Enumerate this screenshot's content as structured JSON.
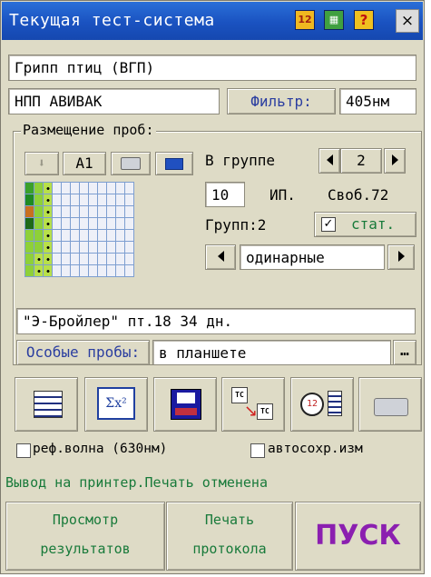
{
  "window": {
    "title": "Текущая тест-система",
    "close_label": "×",
    "icons": [
      "calc-icon",
      "table-icon",
      "help-icon"
    ]
  },
  "test_system": "Грипп птиц (ВГП)",
  "kit": "НПП АВИВАК",
  "filter": {
    "label": "Фильтр:",
    "value": "405нм"
  },
  "placement": {
    "legend": "Размещение проб:",
    "position_label": "А1",
    "in_group_label": "В группе",
    "in_group_value": "2",
    "count_value": "10",
    "ip_label": "ИП.",
    "free_label": "Своб.72",
    "groups_label": "Групп:2",
    "stat_label": "стат.",
    "stat_checked": true,
    "mode_value": "одинарные"
  },
  "plate": {
    "columns": 12,
    "rows": 8,
    "fills": [
      [
        "#3aa02a",
        "#8ed038",
        "#b8e04a"
      ],
      [
        "#1e8a22",
        "#8ed038",
        "#b8e04a"
      ],
      [
        "#c87020",
        "#8ed038",
        "#b8e04a"
      ],
      [
        "#1e6a18",
        "#8ed038",
        "#b8e04a"
      ],
      [
        "#8ed038",
        "#8ed038",
        "#b8e04a"
      ],
      [
        "#8ed038",
        "#8ed038",
        "#b8e04a"
      ],
      [
        "#8ed038",
        "#b8e04a",
        "#b8e04a"
      ],
      [
        "#8ed038",
        "#b8e04a",
        "#b8e04a"
      ]
    ]
  },
  "sample_info": "\"Э-Бройлер\" пт.18 34 дн.",
  "special": {
    "label": "Особые пробы:",
    "value": "в планшете",
    "more_label": "…"
  },
  "toolbar": {
    "icons": [
      "samples-icon",
      "calc-formula-icon",
      "save-icon",
      "tc-transfer-icon",
      "schedule-icon",
      "printer-icon"
    ]
  },
  "options": {
    "ref_wave": "реф.волна (630нм)",
    "autosave": "автосохр.изм"
  },
  "status": "Вывод на принтер.Печать отменена",
  "buttons": {
    "view_results": [
      "Просмотр",
      "результатов"
    ],
    "print_protocol": [
      "Печать",
      "протокола"
    ],
    "start": "ПУСК"
  },
  "colors": {
    "accent": "#1a52c0",
    "start": "#8b1fb0",
    "label_blue": "#2b3ea0",
    "status_green": "#187a3a"
  }
}
